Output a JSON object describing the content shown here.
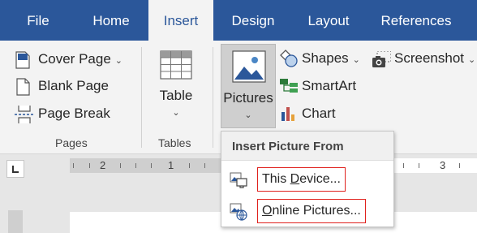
{
  "tabs": [
    {
      "label": "File",
      "active": false
    },
    {
      "label": "Home",
      "active": false
    },
    {
      "label": "Insert",
      "active": true
    },
    {
      "label": "Design",
      "active": false
    },
    {
      "label": "Layout",
      "active": false
    },
    {
      "label": "References",
      "active": false
    }
  ],
  "pages_group": {
    "label": "Pages",
    "cover_page": "Cover Page",
    "blank_page": "Blank Page",
    "page_break": "Page Break"
  },
  "tables_group": {
    "label": "Tables",
    "table": "Table"
  },
  "illustrations": {
    "pictures": "Pictures",
    "shapes": "Shapes",
    "smartart": "SmartArt",
    "chart": "Chart",
    "screenshot": "Screenshot"
  },
  "ruler": {
    "numbers": [
      "2",
      "1",
      "3"
    ]
  },
  "dropdown": {
    "header": "Insert Picture From",
    "this_device": {
      "underline": "D",
      "before": "This ",
      "after": "evice..."
    },
    "online_pictures": {
      "underline": "O",
      "before": "",
      "after": "nline Pictures..."
    }
  },
  "colors": {
    "tabbar": "#2b579a",
    "ribbon": "#f3f3f3",
    "highlight_box": "#e0211d"
  }
}
